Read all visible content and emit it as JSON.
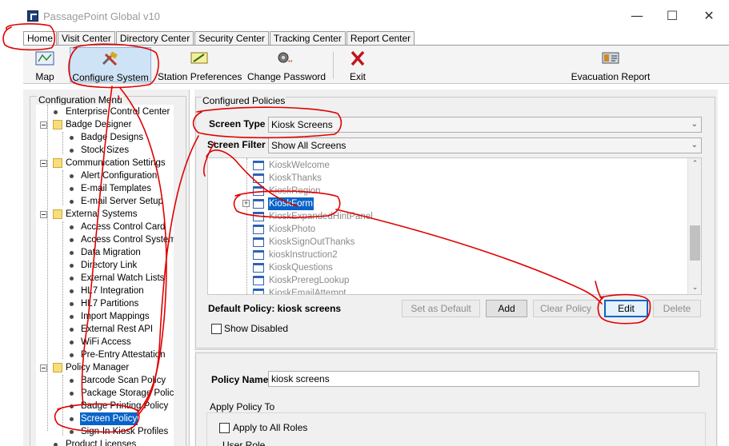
{
  "window": {
    "title": "PassagePoint Global v10"
  },
  "tabs": [
    "Home",
    "Visit Center",
    "Directory Center",
    "Security Center",
    "Tracking Center",
    "Report Center"
  ],
  "toolbar": {
    "map": "Map",
    "configure_system": "Configure System",
    "station_preferences": "Station Preferences",
    "change_password": "Change Password",
    "exit": "Exit",
    "evacuation_report": "Evacuation Report"
  },
  "config_menu": {
    "title": "Configuration Menu",
    "items": [
      "Enterprise Control Center",
      "Badge Designer",
      "Badge Designs",
      "Stock Sizes",
      "Communication Settings",
      "Alert Configuration",
      "E-mail Templates",
      "E-mail Server Setup",
      "External Systems",
      "Access Control Card",
      "Access Control Systems",
      "Data Migration",
      "Directory Link",
      "External Watch Lists",
      "HL7 Integration",
      "HL7 Partitions",
      "Import Mappings",
      "External Rest API",
      "WiFi Access",
      "Pre-Entry Attestation",
      "Policy Manager",
      "Barcode Scan Policy",
      "Package Storage Policy",
      "Badge Printing Policy",
      "Screen Policy",
      "Sign-In Kiosk Profiles",
      "Product Licenses"
    ]
  },
  "configured_policies": {
    "title": "Configured Policies",
    "screen_type_label": "Screen Type",
    "screen_type_value": "Kiosk Screens",
    "screen_filter_label": "Screen Filter",
    "screen_filter_value": "Show All Screens",
    "screens": [
      "KioskWelcome",
      "KioskThanks",
      "KioskRegion",
      "KioskForm",
      "KioskExpandedHintPanel",
      "KioskPhoto",
      "KioskSignOutThanks",
      "kioskInstruction2",
      "KioskQuestions",
      "KioskPreregLookup",
      "KioskEmailAttempt"
    ],
    "default_policy": "Default Policy: kiosk screens",
    "buttons": {
      "set_as_default": "Set as Default",
      "add": "Add",
      "clear_policy": "Clear Policy",
      "edit": "Edit",
      "delete": "Delete"
    },
    "show_disabled": "Show Disabled"
  },
  "policy_detail": {
    "policy_name_label": "Policy Name",
    "policy_name_value": "kiosk screens",
    "apply_policy_to": "Apply Policy To",
    "apply_all_roles": "Apply to All Roles",
    "user_role": "User Role"
  },
  "colors": {
    "selection": "#0a64c8",
    "annotation": "#e00000"
  }
}
